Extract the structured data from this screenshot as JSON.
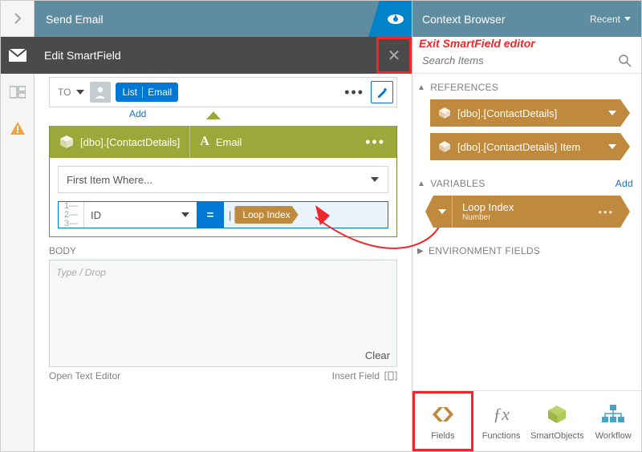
{
  "header": {
    "title": "Send Email"
  },
  "edit_bar": {
    "title": "Edit SmartField"
  },
  "annotation": {
    "exit_label": "Exit SmartField editor"
  },
  "to": {
    "label": "TO",
    "tag_left": "List",
    "tag_right": "Email",
    "add": "Add"
  },
  "sf": {
    "object_label": "[dbo].[ContactDetails]",
    "field_label": "Email",
    "filter_label": "First Item Where...",
    "id_label": "ID",
    "eq": "=",
    "value_chip": "Loop Index"
  },
  "body": {
    "label": "BODY",
    "placeholder": "Type / Drop",
    "clear": "Clear",
    "open_editor": "Open Text Editor",
    "insert_field": "Insert Field"
  },
  "ctx": {
    "title": "Context Browser",
    "recent": "Recent",
    "search_placeholder": "Search Items",
    "sections": {
      "references": "REFERENCES",
      "variables": "VARIABLES",
      "env": "ENVIRONMENT FIELDS",
      "add": "Add"
    },
    "refs": [
      "[dbo].[ContactDetails]",
      "[dbo].[ContactDetails] Item"
    ],
    "var": {
      "name": "Loop Index",
      "type": "Number"
    }
  },
  "tabs": {
    "fields": "Fields",
    "functions": "Functions",
    "smartobjects": "SmartObjects",
    "workflow": "Workflow"
  }
}
